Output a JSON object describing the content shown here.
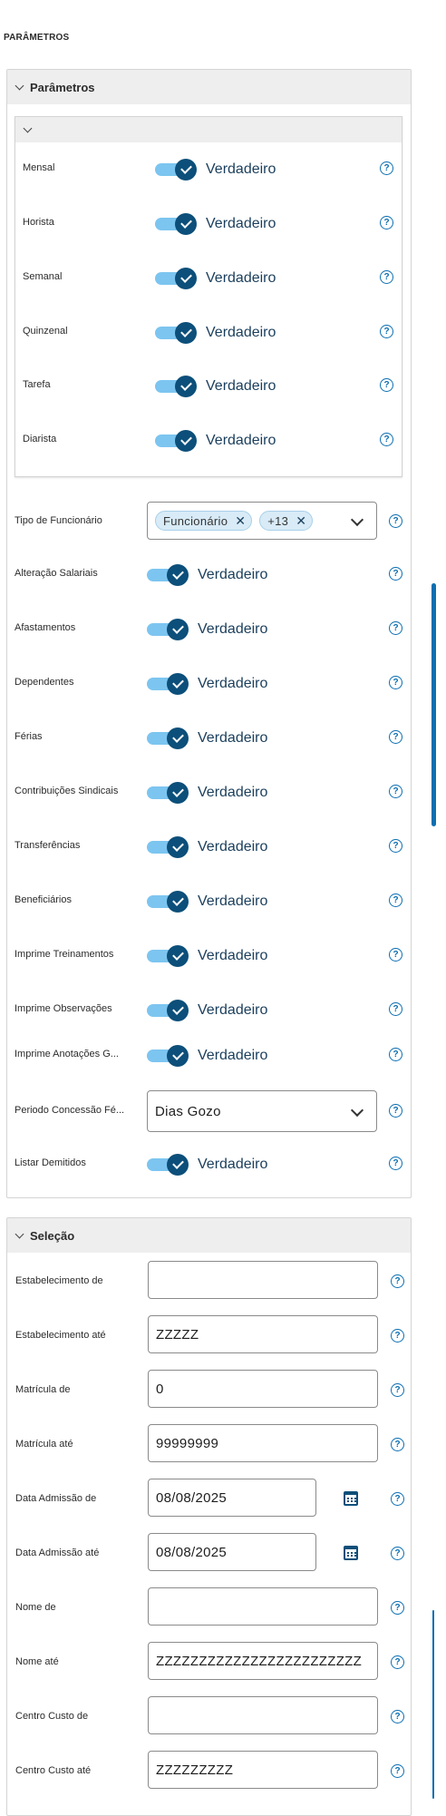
{
  "page_title": "PARÂMETROS",
  "parametros": {
    "header": "Parâmetros",
    "sub_items": [
      {
        "label": "Mensal",
        "value": "Verdadeiro"
      },
      {
        "label": "Horista",
        "value": "Verdadeiro"
      },
      {
        "label": "Semanal",
        "value": "Verdadeiro"
      },
      {
        "label": "Quinzenal",
        "value": "Verdadeiro"
      },
      {
        "label": "Tarefa",
        "value": "Verdadeiro"
      },
      {
        "label": "Diarista",
        "value": "Verdadeiro"
      }
    ],
    "tipo_funcionario": {
      "label": "Tipo de Funcionário",
      "tags": [
        "Funcionário",
        "+13"
      ]
    },
    "toggles": [
      {
        "label": "Alteração Salariais",
        "value": "Verdadeiro"
      },
      {
        "label": "Afastamentos",
        "value": "Verdadeiro"
      },
      {
        "label": "Dependentes",
        "value": "Verdadeiro"
      },
      {
        "label": "Férias",
        "value": "Verdadeiro"
      },
      {
        "label": "Contribuições Sindicais",
        "value": "Verdadeiro"
      },
      {
        "label": "Transferências",
        "value": "Verdadeiro"
      },
      {
        "label": "Beneficiários",
        "value": "Verdadeiro"
      },
      {
        "label": "Imprime Treinamentos",
        "value": "Verdadeiro"
      },
      {
        "label": "Imprime Observações",
        "value": "Verdadeiro"
      },
      {
        "label": "Imprime Anotações G...",
        "value": "Verdadeiro"
      }
    ],
    "periodo": {
      "label": "Periodo Concessão Fé...",
      "value": "Dias Gozo"
    },
    "listar_demitidos": {
      "label": "Listar Demitidos",
      "value": "Verdadeiro"
    }
  },
  "selecao": {
    "header": "Seleção",
    "fields": [
      {
        "label": "Estabelecimento de",
        "value": ""
      },
      {
        "label": "Estabelecimento até",
        "value": "ZZZZZ"
      },
      {
        "label": "Matrícula de",
        "value": "0"
      },
      {
        "label": "Matrícula até",
        "value": "99999999"
      },
      {
        "label": "Data Admissão de",
        "value": "08/08/2025"
      },
      {
        "label": "Data Admissão até",
        "value": "08/08/2025"
      },
      {
        "label": "Nome de",
        "value": ""
      },
      {
        "label": "Nome até",
        "value": "ZZZZZZZZZZZZZZZZZZZZZZZZ"
      },
      {
        "label": "Centro Custo de",
        "value": ""
      },
      {
        "label": "Centro Custo até",
        "value": "ZZZZZZZZZ"
      }
    ]
  },
  "help_symbol": "?",
  "remove_symbol": "✕",
  "colors": {
    "accent": "#0c4f7a",
    "toggle_track": "#7cc5f0",
    "help": "#0c6fb2",
    "header_bg": "#eeeeee"
  }
}
